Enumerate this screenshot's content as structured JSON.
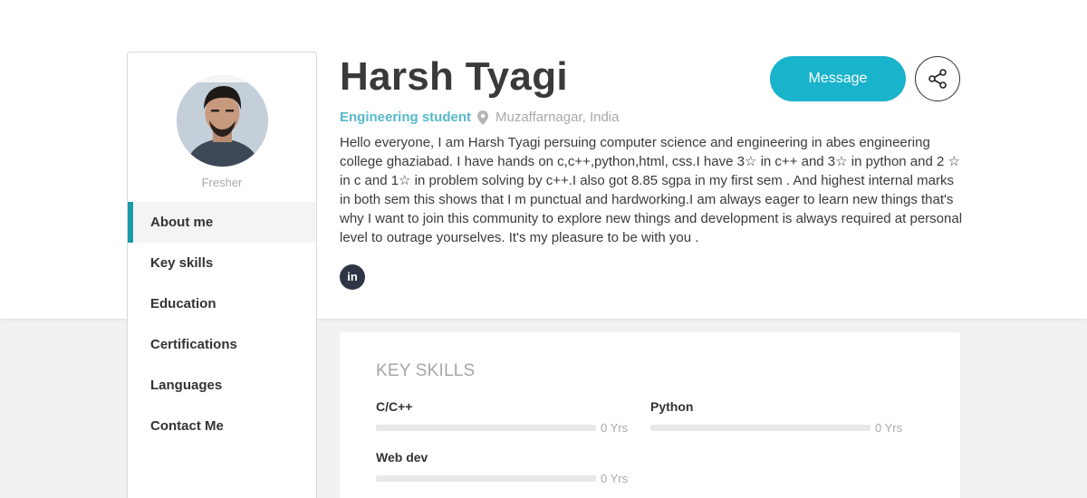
{
  "profile": {
    "name": "Harsh Tyagi",
    "headline": "Engineering student",
    "location": "Muzaffarnagar, India",
    "role": "Fresher",
    "bio": "Hello everyone, I am Harsh Tyagi persuing computer science and engineering in abes engineering college ghaziabad. I have hands on c,c++,python,html, css.I have 3☆ in c++ and 3☆ in python and 2 ☆ in c and 1☆ in problem solving by c++.I also got 8.85 sgpa in my first sem . And highest internal marks in both sem this shows that I m punctual and hardworking.I am always eager to learn new things that's why I want to join this community to explore new things and development is always required at personal level to outrage yourselves. It's my pleasure to be with you .",
    "social": {
      "linkedin_label": "in"
    }
  },
  "actions": {
    "message_label": "Message",
    "share_icon": "share-icon"
  },
  "sidebar": {
    "items": [
      {
        "label": "About me",
        "active": true
      },
      {
        "label": "Key skills",
        "active": false
      },
      {
        "label": "Education",
        "active": false
      },
      {
        "label": "Certifications",
        "active": false
      },
      {
        "label": "Languages",
        "active": false
      },
      {
        "label": "Contact Me",
        "active": false
      }
    ]
  },
  "skills": {
    "title": "KEY SKILLS",
    "items": [
      {
        "name": "C/C++",
        "years": "0 Yrs",
        "level": 0
      },
      {
        "name": "Python",
        "years": "0 Yrs",
        "level": 0
      },
      {
        "name": "Web dev",
        "years": "0 Yrs",
        "level": 0
      }
    ]
  },
  "colors": {
    "accent": "#19b3cc",
    "active_indicator": "#199ca8",
    "headline": "#55b9c9",
    "linkedin_bg": "#2e3544"
  }
}
